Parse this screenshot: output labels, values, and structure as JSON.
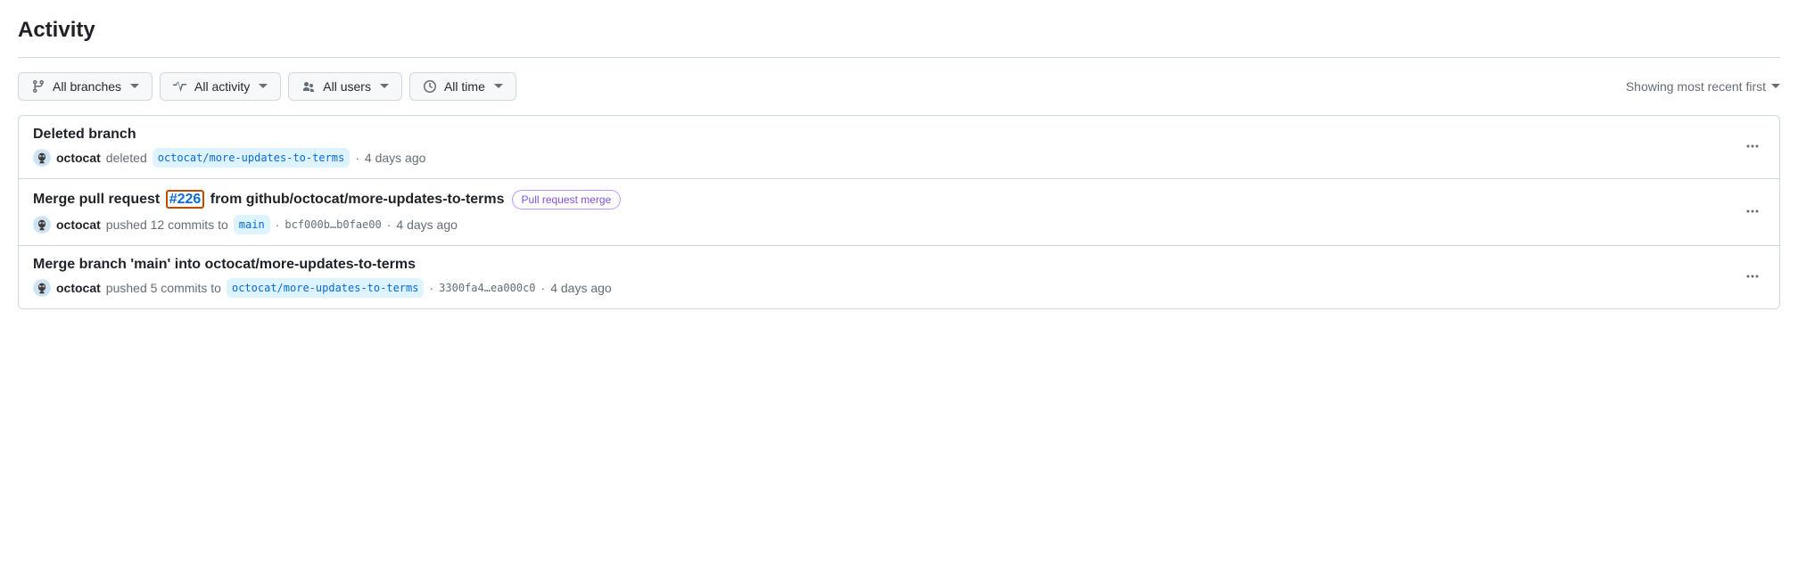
{
  "header": {
    "title": "Activity"
  },
  "filters": {
    "branches": "All branches",
    "activity": "All activity",
    "users": "All users",
    "time": "All time"
  },
  "sort": {
    "label": "Showing most recent first"
  },
  "activities": [
    {
      "title_full": "Deleted branch",
      "user": "octocat",
      "action": "deleted",
      "branch": "octocat/more-updates-to-terms",
      "time": "4 days ago"
    },
    {
      "title_pre": "Merge pull request ",
      "pr_number": "#226",
      "title_post": " from github/octocat/more-updates-to-terms",
      "badge": "Pull request merge",
      "user": "octocat",
      "action": "pushed 12 commits to",
      "branch": "main",
      "hash": "bcf000b…b0fae00",
      "time": "4 days ago"
    },
    {
      "title_full": "Merge branch 'main' into octocat/more-updates-to-terms",
      "user": "octocat",
      "action": "pushed 5 commits to",
      "branch": "octocat/more-updates-to-terms",
      "hash": "3300fa4…ea000c0",
      "time": "4 days ago"
    }
  ]
}
